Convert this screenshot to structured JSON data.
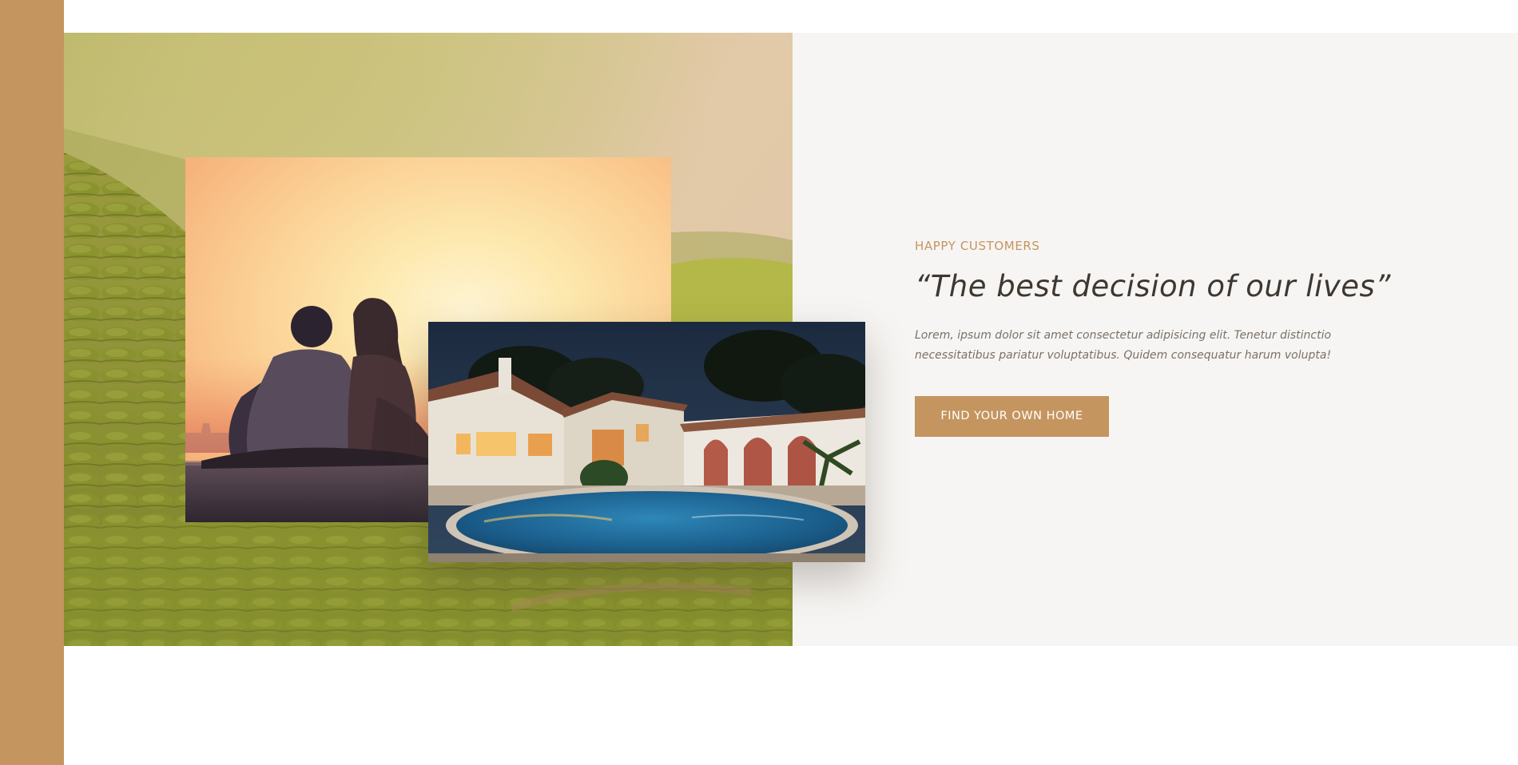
{
  "testimonial": {
    "eyebrow": "HAPPY CUSTOMERS",
    "quote": "“The best decision of our lives”",
    "body": "Lorem, ipsum dolor sit amet consectetur adipisicing elit. Tenetur distinctio necessitatibus pariatur voluptatibus. Quidem consequatur harum volupta!",
    "cta_label": "FIND YOUR OWN HOME"
  },
  "colors": {
    "accent": "#c4955f",
    "section_background": "#f7f5f3",
    "heading": "#3e3731",
    "body_text": "#7a7068"
  }
}
